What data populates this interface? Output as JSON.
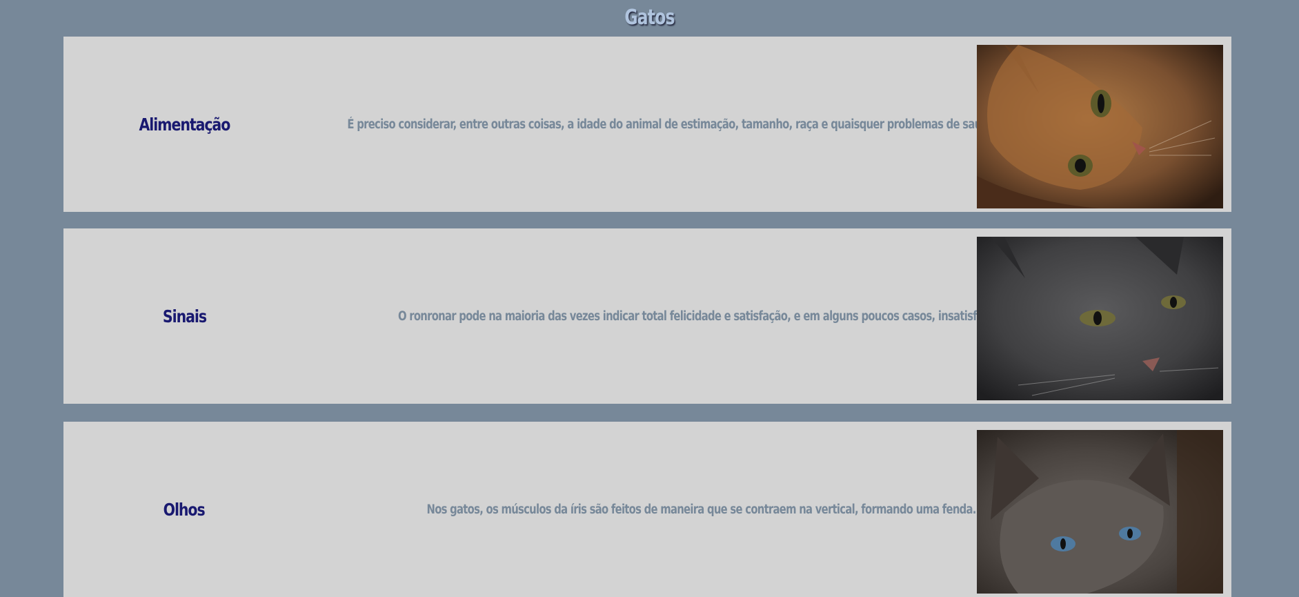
{
  "page": {
    "title": "Gatos"
  },
  "cards": [
    {
      "title": "Alimentação",
      "description": "É preciso considerar, entre outras coisas, a idade do animal de estimação, tamanho, raça e quaisquer problemas de saúde existentes.",
      "image_icon": "orange-cat-photo"
    },
    {
      "title": "Sinais",
      "description": "O ronronar pode na maioria das vezes indicar total felicidade e satisfação, e em alguns poucos casos, insatisfação.",
      "image_icon": "gray-cat-photo"
    },
    {
      "title": "Olhos",
      "description": "Nos gatos, os músculos da íris são feitos de maneira que se contraem na vertical, formando uma fenda.",
      "image_icon": "siamese-cat-photo"
    }
  ],
  "colors": {
    "background": "#778899",
    "card": "#d3d3d3",
    "card_title": "#191970",
    "card_text": "#778899",
    "page_title": "#b0c4de"
  }
}
